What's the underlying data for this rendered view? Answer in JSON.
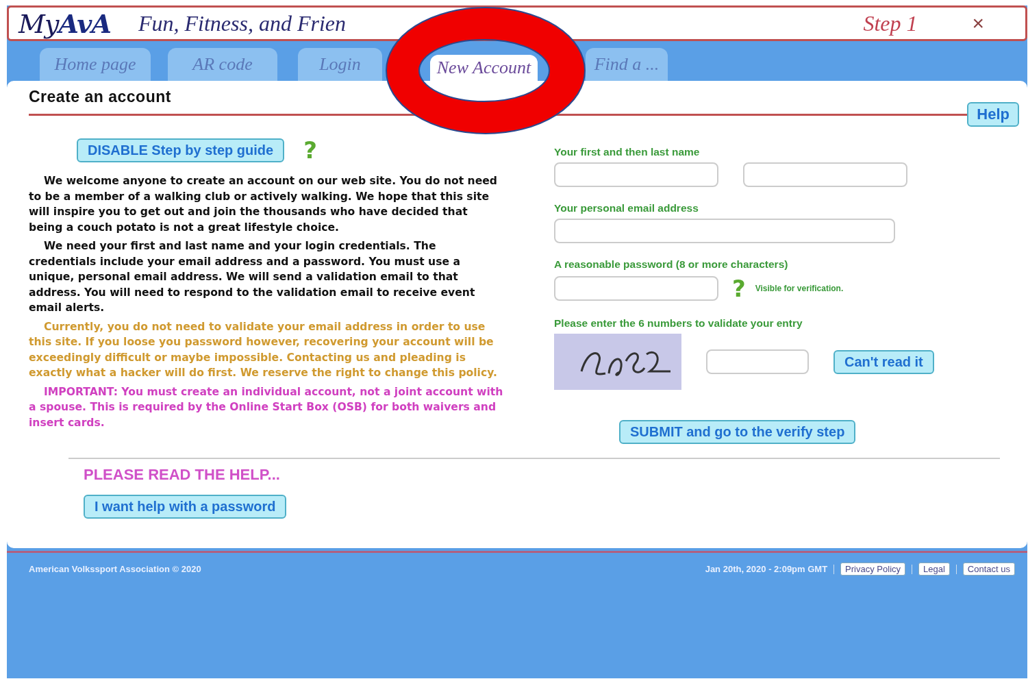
{
  "header": {
    "logo": "My**AvA**",
    "tagline": "Fun, Fitness, and Frien",
    "step": "Step 1",
    "close": "×"
  },
  "tabs": [
    {
      "label": "Home page",
      "selected": false
    },
    {
      "label": "AR code",
      "selected": false
    },
    {
      "label": "Login",
      "selected": false
    },
    {
      "label": "New Account",
      "selected": true
    },
    {
      "label": "Find a ...",
      "selected": false
    }
  ],
  "page": {
    "title": "Create an account",
    "help": "Help"
  },
  "guide": {
    "button": "DISABLE Step by step guide",
    "hint": "?"
  },
  "paragraphs": [
    {
      "kind": "normal",
      "text": "We welcome anyone to create an account on our web site. You do not need to be a member of a walking club or actively walking. We hope that this site will inspire you to get out and join the thousands who have decided that being a couch potato is not a great lifestyle choice."
    },
    {
      "kind": "normal",
      "text": "We need your first and last name and your login credentials. The credentials include your email address and a password. You must use a unique, personal email address. We will send a validation email to that address. You will need to respond to the validation email to receive event email alerts."
    },
    {
      "kind": "warning",
      "text": "Currently, you do not need to validate your email address in order to use this site. If you loose you password however, recovering your account will be exceedingly difficult or maybe impossible. Contacting us and pleading is exactly what a hacker will do first. We reserve the right to change this policy."
    },
    {
      "kind": "important",
      "text": "IMPORTANT: You must create an individual account, not a joint account with a spouse. This is required by the Online Start Box (OSB) for both waivers and insert cards."
    }
  ],
  "form": {
    "name_label": "Your first and then last name",
    "email_label": "Your personal email address",
    "password_label": "A reasonable password (8 or more characters)",
    "password_hint": "?",
    "visible_note": "Visible for verification.",
    "captcha_label": "Please enter the 6 numbers to validate your entry",
    "cant_read": "Can't read it",
    "submit": "SUBMIT and go to the verify step"
  },
  "read_help": "PLEASE READ THE HELP...",
  "password_help": "I want help with a password",
  "footer": {
    "copyright": "American Volkssport Association © 2020",
    "timestamp": "Jan 20th, 2020 - 2:09pm GMT",
    "links": [
      "Privacy Policy",
      "Legal",
      "Contact us"
    ]
  }
}
